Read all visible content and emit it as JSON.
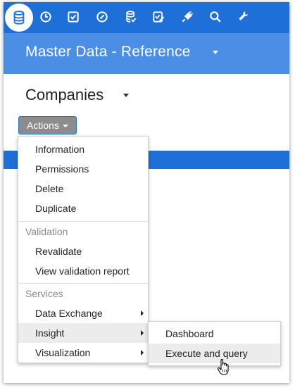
{
  "toolbar": {
    "icons": [
      "database-icon",
      "clock-icon",
      "checkbox-icon",
      "gauge-icon",
      "database-check-icon",
      "edit-check-icon",
      "plug-icon",
      "search-icon",
      "wrench-icon"
    ],
    "background_color": "#1f6fd8"
  },
  "header": {
    "title": "Master Data - Reference",
    "background_color": "#4a8ee6"
  },
  "page": {
    "title": "Companies"
  },
  "actions": {
    "label": "Actions"
  },
  "menu": {
    "items": [
      {
        "label": "Information"
      },
      {
        "label": "Permissions"
      },
      {
        "label": "Delete"
      },
      {
        "label": "Duplicate"
      }
    ],
    "validation_header": "Validation",
    "validation_items": [
      {
        "label": "Revalidate"
      },
      {
        "label": "View validation report"
      }
    ],
    "services_header": "Services",
    "services_items": [
      {
        "label": "Data Exchange",
        "has_submenu": true
      },
      {
        "label": "Insight",
        "has_submenu": true,
        "highlighted": true
      },
      {
        "label": "Visualization",
        "has_submenu": true
      }
    ]
  },
  "submenu": {
    "items": [
      {
        "label": "Dashboard"
      },
      {
        "label": "Execute and query",
        "highlighted": true
      }
    ]
  }
}
